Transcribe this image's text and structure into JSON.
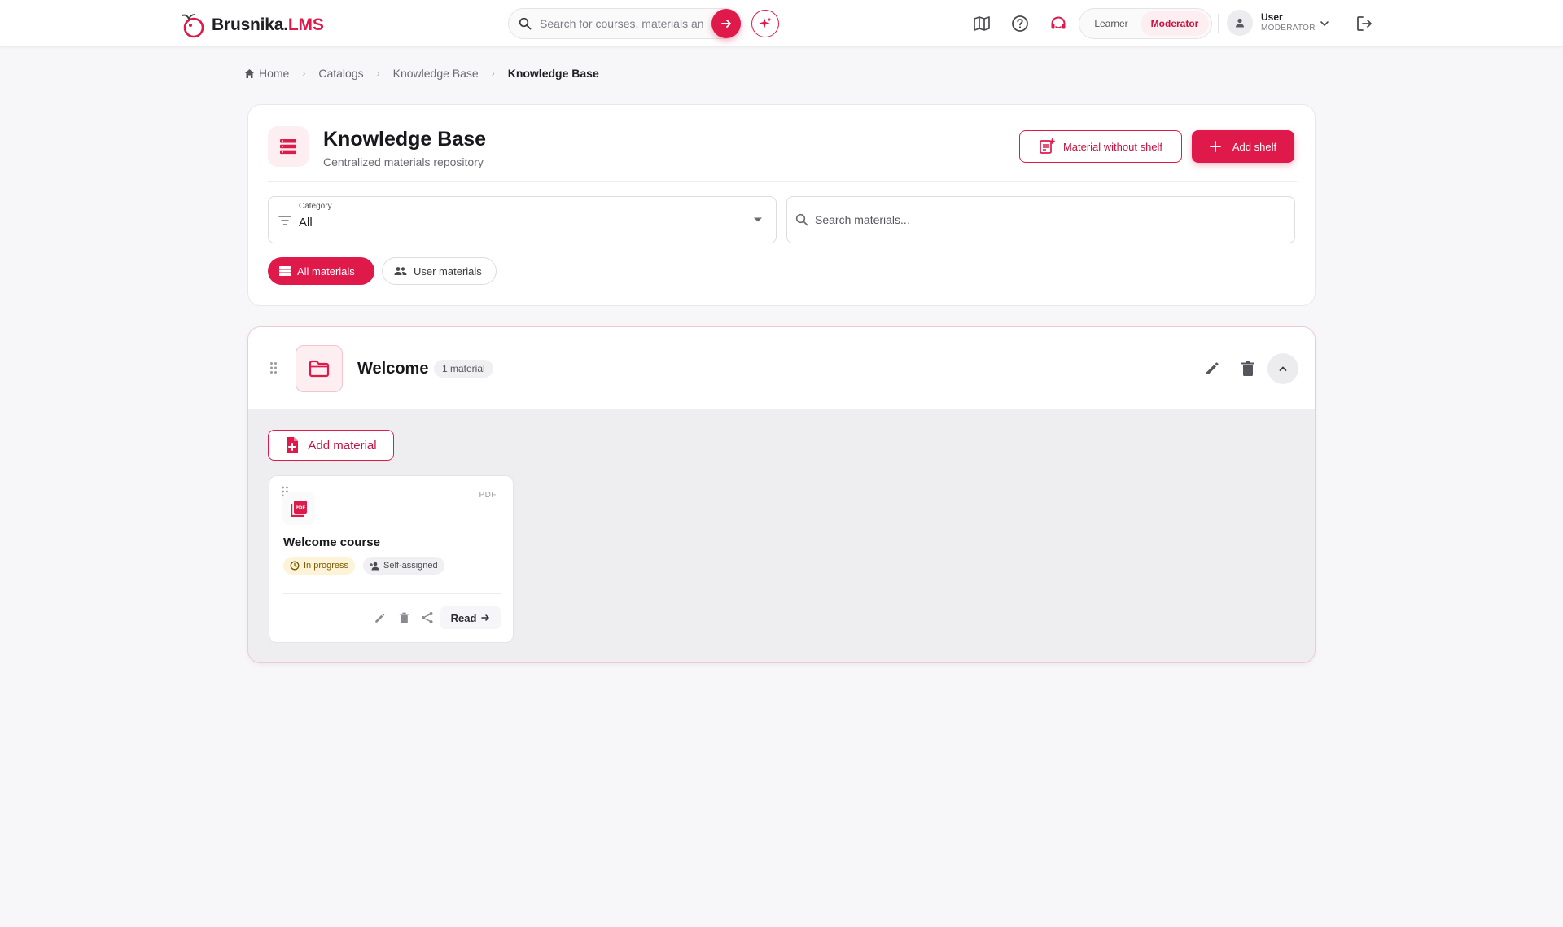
{
  "brand": {
    "name_part1": "Brusnika.",
    "name_part2": "LMS",
    "icon": "berry-logo-icon"
  },
  "topbar": {
    "search_placeholder": "Search for courses, materials and more",
    "icons": [
      "search-icon",
      "arrow-right-icon",
      "sparkle-icon",
      "map-icon",
      "help-icon",
      "support-icon",
      "logout-icon"
    ],
    "roles": [
      "Learner",
      "Moderator"
    ],
    "active_role": "Moderator",
    "user": {
      "name": "User",
      "role": "MODERATOR"
    }
  },
  "breadcrumb": [
    {
      "label": "Home",
      "icon": "home-icon"
    },
    {
      "label": "Catalogs"
    },
    {
      "label": "Knowledge Base"
    },
    {
      "label": "Knowledge Base",
      "current": true
    }
  ],
  "header": {
    "title": "Knowledge Base",
    "subtitle": "Centralized materials repository",
    "material_without_shelf_label": "Material without shelf",
    "add_shelf_label": "Add shelf",
    "category": {
      "label": "Category",
      "value": "All"
    },
    "search_placeholder": "Search materials...",
    "filters": [
      {
        "label": "All materials",
        "active": true
      },
      {
        "label": "User materials",
        "active": false
      }
    ]
  },
  "shelves": [
    {
      "title": "Welcome",
      "count_label": "1 material",
      "add_material_label": "Add material",
      "materials": [
        {
          "type": "PDF",
          "title": "Welcome course",
          "status": "In progress",
          "assignment": "Self-assigned",
          "read_label": "Read"
        }
      ]
    }
  ],
  "colors": {
    "accent": "#e0194b",
    "accent_soft": "#fdeef2",
    "status_progress_bg": "#fdf3d8"
  }
}
